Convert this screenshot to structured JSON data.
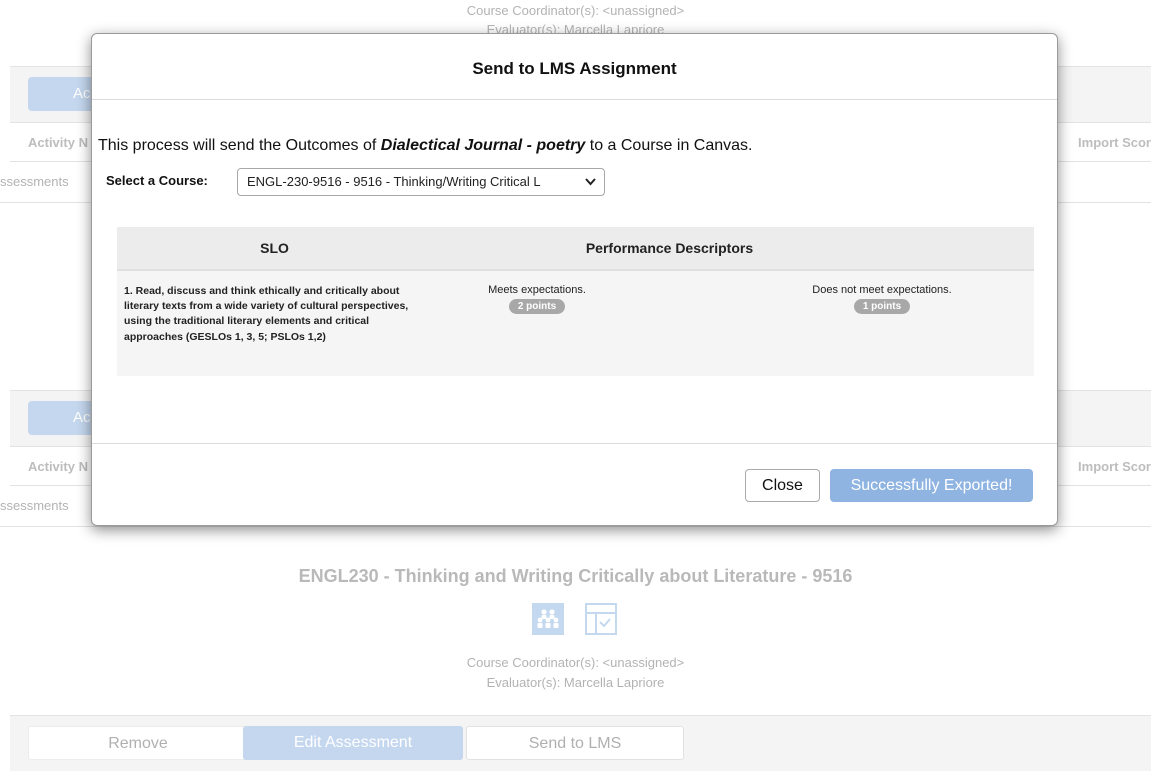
{
  "background": {
    "top_coordinators": "Course Coordinator(s): <unassigned>",
    "top_evaluators": "Evaluator(s): Marcella Lapriore",
    "add_button_label": "Ac",
    "col_activity": "Activity N",
    "col_import_score": "Import Scor",
    "assessments_label": "ssessments",
    "course_title": "ENGL230 - Thinking and Writing Critically about Literature - 9516",
    "coordinators": "Course Coordinator(s): <unassigned>",
    "evaluators": "Evaluator(s): Marcella Lapriore",
    "bottom_buttons": {
      "remove": "Remove",
      "edit_assessment": "Edit Assessment",
      "send_to_lms": "Send to LMS"
    }
  },
  "modal": {
    "title": "Send to LMS Assignment",
    "intro_prefix": "This process will send the Outcomes of ",
    "activity_name": "Dialectical Journal - poetry",
    "intro_suffix": " to a Course in Canvas.",
    "select_label": "Select a Course:",
    "selected_course": "ENGL-230-9516 - 9516 - Thinking/Writing Critical L",
    "table": {
      "header_slo": "SLO",
      "header_performance": "Performance Descriptors",
      "rows": [
        {
          "slo": "1. Read, discuss and think ethically and critically about literary texts from a wide variety of cultural perspectives, using the traditional literary elements and critical approaches (GESLOs 1, 3, 5; PSLOs 1,2)",
          "descriptors": [
            {
              "label": "Meets expectations.",
              "points": "2 points"
            },
            {
              "label": "Does not meet expectations.",
              "points": "1 points"
            }
          ]
        }
      ]
    },
    "close_button": "Close",
    "status_button": "Successfully Exported!"
  }
}
